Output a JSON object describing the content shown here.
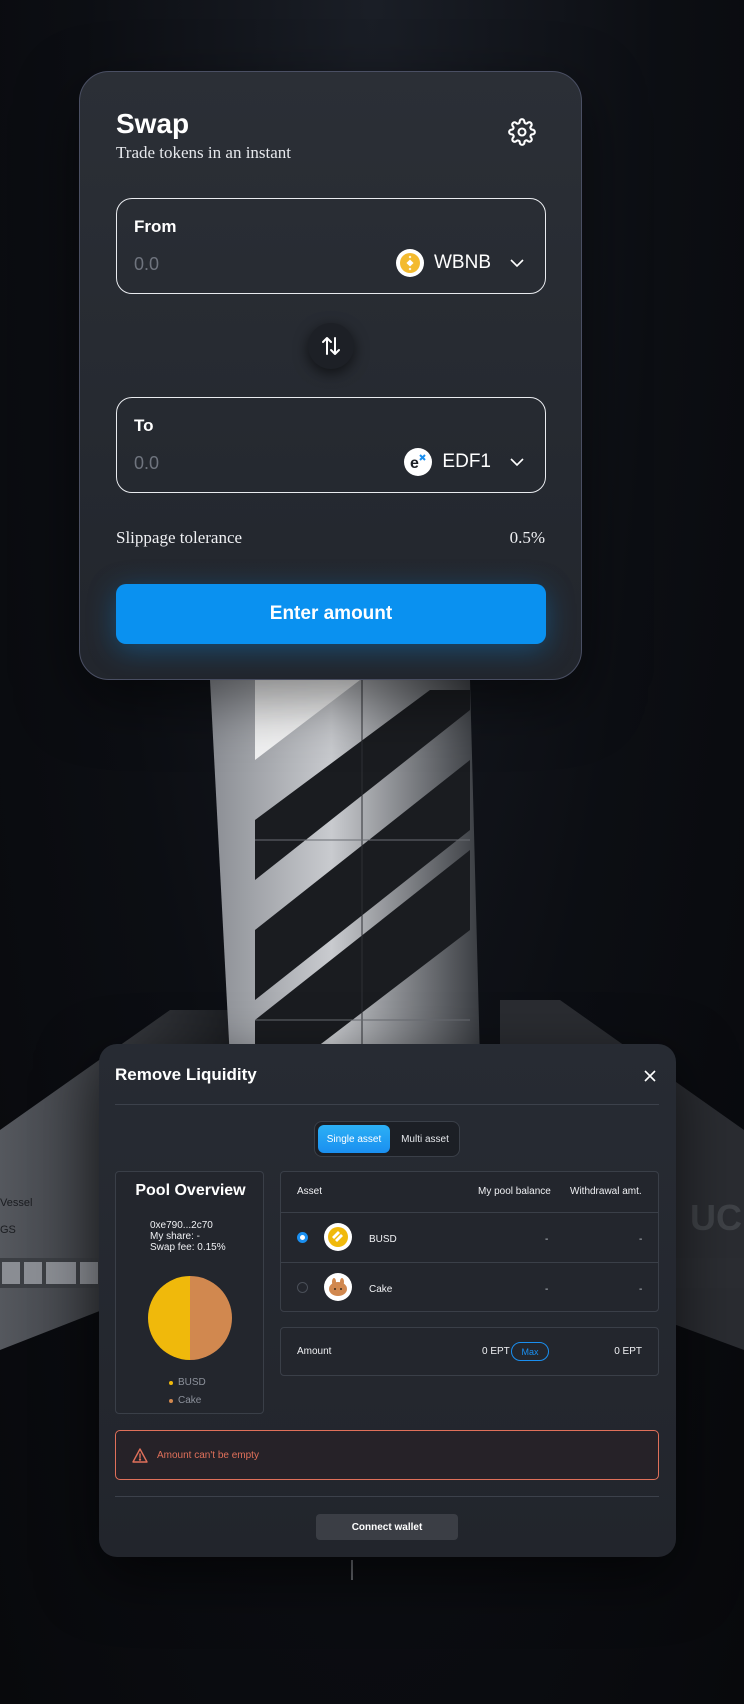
{
  "swap": {
    "title": "Swap",
    "subtitle": "Trade tokens in an instant",
    "from": {
      "label": "From",
      "value": "0.0",
      "token": "WBNB"
    },
    "to": {
      "label": "To",
      "value": "0.0",
      "token": "EDF1"
    },
    "slippage_label": "Slippage tolerance",
    "slippage_value": "0.5%",
    "submit_label": "Enter amount",
    "accent_color": "#0a91f0",
    "icons": {
      "settings": "gear-icon",
      "switch": "swap-arrows-icon",
      "dropdown": "chevron-down-icon"
    }
  },
  "background": {
    "left_text_1": "Vessel",
    "left_text_2": "GS",
    "right_text": "UC"
  },
  "remove_liquidity": {
    "title": "Remove Liquidity",
    "tabs": {
      "single": "Single asset",
      "multi": "Multi asset",
      "active": "single"
    },
    "pool": {
      "title": "Pool Overview",
      "address": "0xe790...2c70",
      "share": "My share: -",
      "fee": "Swap fee: 0.15%",
      "legend": [
        {
          "name": "BUSD",
          "color": "#f0b90b"
        },
        {
          "name": "Cake",
          "color": "#d1884f"
        }
      ],
      "share_split": [
        0.5,
        0.5
      ]
    },
    "table": {
      "headers": {
        "asset": "Asset",
        "balance": "My pool balance",
        "withdrawal": "Withdrawal amt."
      },
      "rows": [
        {
          "name": "BUSD",
          "balance": "-",
          "withdrawal": "-",
          "selected": true
        },
        {
          "name": "Cake",
          "balance": "-",
          "withdrawal": "-",
          "selected": false
        }
      ]
    },
    "amount": {
      "label": "Amount",
      "input": "0 EPT",
      "max_label": "Max",
      "output": "0 EPT"
    },
    "error": "Amount can't be empty",
    "connect_label": "Connect wallet",
    "error_color": "#e0705a"
  }
}
